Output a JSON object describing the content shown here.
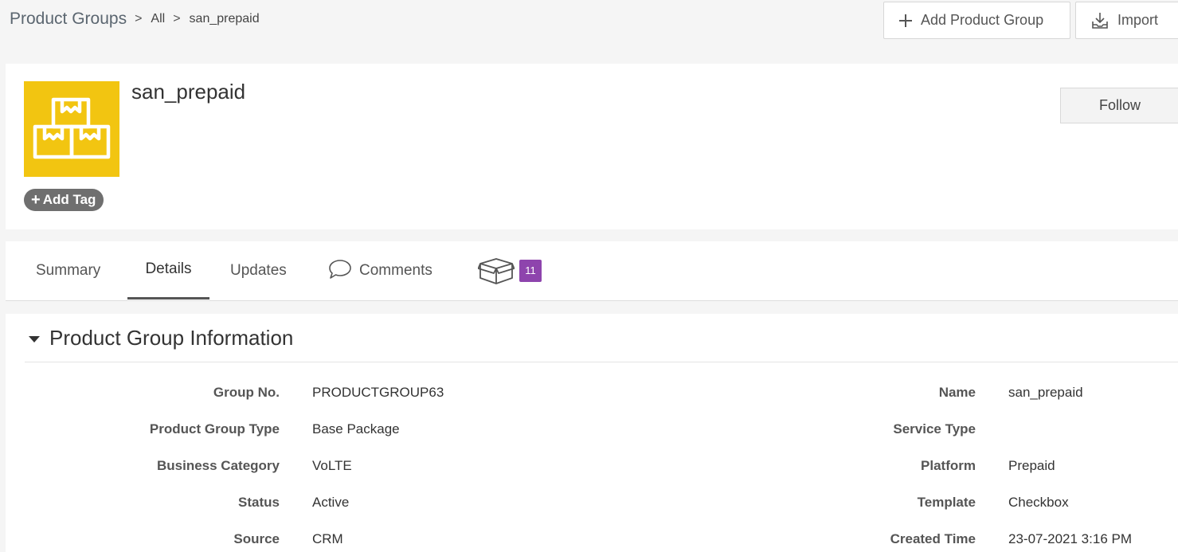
{
  "breadcrumb": {
    "root": "Product Groups",
    "separator": ">",
    "level1": "All",
    "current": "san_prepaid"
  },
  "toolbar": {
    "add_label": "Add Product Group",
    "import_label": "Import"
  },
  "record": {
    "title": "san_prepaid",
    "add_tag_label": "Add Tag",
    "follow_label": "Follow",
    "image_icon": "boxes-icon",
    "image_color": "#f2c511"
  },
  "tabs": {
    "summary": "Summary",
    "details": "Details",
    "updates": "Updates",
    "comments": "Comments",
    "products_count": "11",
    "products_icon": "open-box-icon",
    "active": "Details"
  },
  "section": {
    "title": "Product Group Information",
    "left_fields": [
      {
        "label": "Group No.",
        "value": "PRODUCTGROUP63"
      },
      {
        "label": "Product Group Type",
        "value": "Base Package"
      },
      {
        "label": "Business Category",
        "value": "VoLTE"
      },
      {
        "label": "Status",
        "value": "Active"
      },
      {
        "label": "Source",
        "value": "CRM"
      }
    ],
    "right_fields": [
      {
        "label": "Name",
        "value": "san_prepaid"
      },
      {
        "label": "Service Type",
        "value": ""
      },
      {
        "label": "Platform",
        "value": "Prepaid"
      },
      {
        "label": "Template",
        "value": "Checkbox"
      },
      {
        "label": "Created Time",
        "value": "23-07-2021 3:16 PM"
      }
    ]
  },
  "colors": {
    "badge": "#8e44ad",
    "tag": "#6f6f6f"
  }
}
